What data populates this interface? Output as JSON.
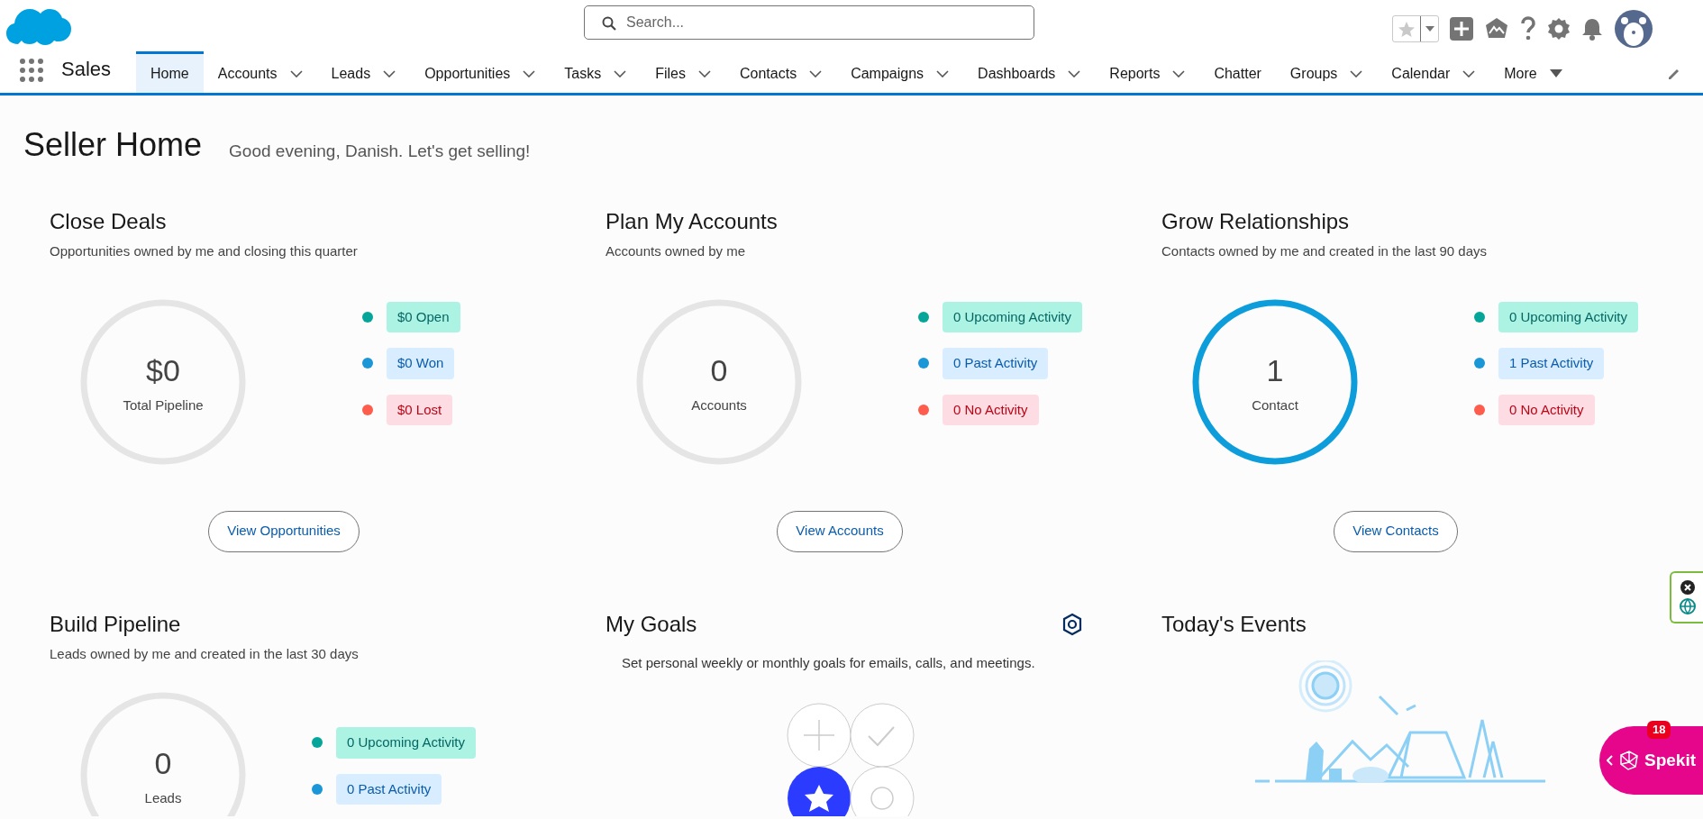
{
  "search": {
    "placeholder": "Search..."
  },
  "app_name": "Sales",
  "nav": [
    {
      "label": "Home",
      "selected": true,
      "kind": "plain"
    },
    {
      "label": "Accounts",
      "selected": false,
      "kind": "dropdown"
    },
    {
      "label": "Leads",
      "selected": false,
      "kind": "dropdown"
    },
    {
      "label": "Opportunities",
      "selected": false,
      "kind": "dropdown"
    },
    {
      "label": "Tasks",
      "selected": false,
      "kind": "dropdown"
    },
    {
      "label": "Files",
      "selected": false,
      "kind": "dropdown"
    },
    {
      "label": "Contacts",
      "selected": false,
      "kind": "dropdown"
    },
    {
      "label": "Campaigns",
      "selected": false,
      "kind": "dropdown"
    },
    {
      "label": "Dashboards",
      "selected": false,
      "kind": "dropdown"
    },
    {
      "label": "Reports",
      "selected": false,
      "kind": "dropdown"
    },
    {
      "label": "Chatter",
      "selected": false,
      "kind": "plain"
    },
    {
      "label": "Groups",
      "selected": false,
      "kind": "dropdown"
    },
    {
      "label": "Calendar",
      "selected": false,
      "kind": "dropdown"
    },
    {
      "label": "More",
      "selected": false,
      "kind": "more"
    }
  ],
  "page": {
    "title": "Seller Home",
    "greeting": "Good evening, Danish. Let's get selling!"
  },
  "cards": [
    {
      "title": "Close Deals",
      "subtitle": "Opportunities owned by me and closing this quarter",
      "ring": {
        "value": "$0",
        "label": "Total Pipeline",
        "active": false
      },
      "legend": [
        {
          "label": "$0 Open",
          "color": "#06a59a",
          "kind": "positive"
        },
        {
          "label": "$0 Won",
          "color": "#1b96d6",
          "kind": "neutral"
        },
        {
          "label": "$0 Lost",
          "color": "#fe5c4c",
          "kind": "negative"
        }
      ],
      "button": "View Opportunities"
    },
    {
      "title": "Plan My Accounts",
      "subtitle": "Accounts owned by me",
      "ring": {
        "value": "0",
        "label": "Accounts",
        "active": false
      },
      "legend": [
        {
          "label": "0 Upcoming Activity",
          "color": "#06a59a",
          "kind": "positive"
        },
        {
          "label": "0 Past Activity",
          "color": "#1b96d6",
          "kind": "neutral"
        },
        {
          "label": "0 No Activity",
          "color": "#fe5c4c",
          "kind": "negative"
        }
      ],
      "button": "View Accounts"
    },
    {
      "title": "Grow Relationships",
      "subtitle": "Contacts owned by me and created in the last 90 days",
      "ring": {
        "value": "1",
        "label": "Contact",
        "active": true
      },
      "legend": [
        {
          "label": "0 Upcoming Activity",
          "color": "#06a59a",
          "kind": "positive"
        },
        {
          "label": "1 Past Activity",
          "color": "#1b96d6",
          "kind": "neutral"
        },
        {
          "label": "0 No Activity",
          "color": "#fe5c4c",
          "kind": "negative"
        }
      ],
      "button": "View Contacts"
    }
  ],
  "pipeline": {
    "title": "Build Pipeline",
    "subtitle": "Leads owned by me and created in the last 30 days",
    "ring": {
      "value": "0",
      "label": "Leads",
      "active": false
    },
    "legend": [
      {
        "label": "0 Upcoming Activity",
        "color": "#06a59a",
        "kind": "positive"
      },
      {
        "label": "0 Past Activity",
        "color": "#1b96d6",
        "kind": "neutral"
      }
    ]
  },
  "goals": {
    "title": "My Goals",
    "text": "Set personal weekly or monthly goals for emails, calls, and meetings."
  },
  "events": {
    "title": "Today's Events"
  },
  "spekit": {
    "label": "Spekit",
    "badge": "18"
  }
}
